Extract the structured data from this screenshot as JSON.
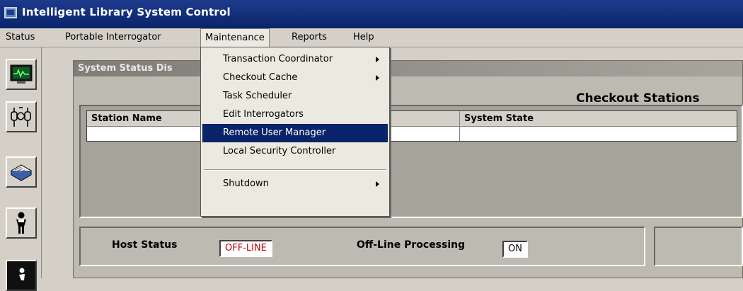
{
  "window": {
    "title": "Intelligent Library System Control"
  },
  "menubar": [
    {
      "label": "Status",
      "open": false
    },
    {
      "label": "Portable Interrogator",
      "open": false
    },
    {
      "label": "Maintenance",
      "open": true
    },
    {
      "label": "Reports",
      "open": false
    },
    {
      "label": "Help",
      "open": false
    }
  ],
  "maintenance_menu": [
    {
      "label": "Transaction Coordinator",
      "submenu": true,
      "selected": false
    },
    {
      "label": "Checkout Cache",
      "submenu": true,
      "selected": false
    },
    {
      "label": "Task Scheduler",
      "submenu": false,
      "selected": false
    },
    {
      "label": "Edit Interrogators",
      "submenu": false,
      "selected": false
    },
    {
      "label": "Remote User Manager",
      "submenu": false,
      "selected": true
    },
    {
      "label": "Local Security Controller",
      "submenu": false,
      "selected": false
    },
    {
      "label": "Shutdown",
      "submenu": true,
      "selected": false
    }
  ],
  "toolbar": [
    {
      "icon": "monitor-waveform-icon"
    },
    {
      "icon": "interrogator-antenna-icon"
    },
    {
      "icon": "book-icon"
    },
    {
      "icon": "person-icon"
    },
    {
      "icon": "walking-person-icon"
    }
  ],
  "panel": {
    "title": "System Status Dis",
    "section_title": "Checkout Stations",
    "columns": [
      "Station Name",
      "",
      "System State"
    ],
    "host_status_label": "Host Status",
    "host_status_value": "OFF-LINE",
    "offline_processing_label": "Off-Line Processing",
    "offline_processing_value": "ON"
  },
  "colors": {
    "titlebar": "#0a246a",
    "selection": "#0a246a",
    "offline_text": "#c00000",
    "window_face": "#d4d0c8"
  }
}
